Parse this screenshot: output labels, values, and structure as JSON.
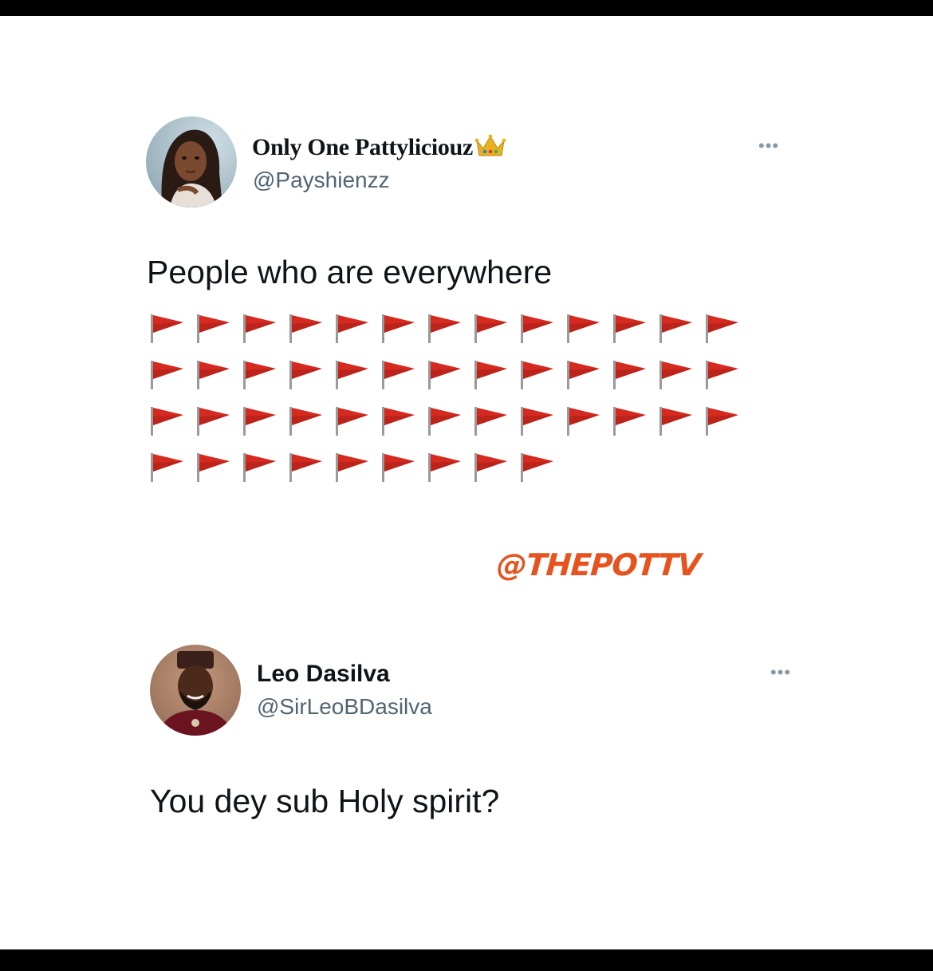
{
  "tweets": [
    {
      "name": "Only One Pattylicioüz",
      "name_text": "Only One Pattyliciouz",
      "name_emoji": "crown",
      "handle": "@Payshienzz",
      "more_label": "•••",
      "text": "People who are everywhere",
      "emoji_rows": [
        {
          "emoji": "triangular-flag",
          "count": 13
        },
        {
          "emoji": "triangular-flag",
          "count": 13
        },
        {
          "emoji": "triangular-flag",
          "count": 13
        },
        {
          "emoji": "triangular-flag",
          "count": 9
        }
      ]
    },
    {
      "name": "Leo Dasilva",
      "handle": "@SirLeoBDasilva",
      "more_label": "•••",
      "text": "You dey sub Holy spirit?"
    }
  ],
  "watermark": "@THEPOTTV",
  "colors": {
    "flag_red": "#d42a1f",
    "watermark": "#e6531e",
    "handle_gray": "#536471",
    "text": "#0f1419"
  },
  "icons": {
    "more": "more-dots-icon",
    "crown": "crown-emoji-icon",
    "flag": "triangular-flag-icon"
  }
}
